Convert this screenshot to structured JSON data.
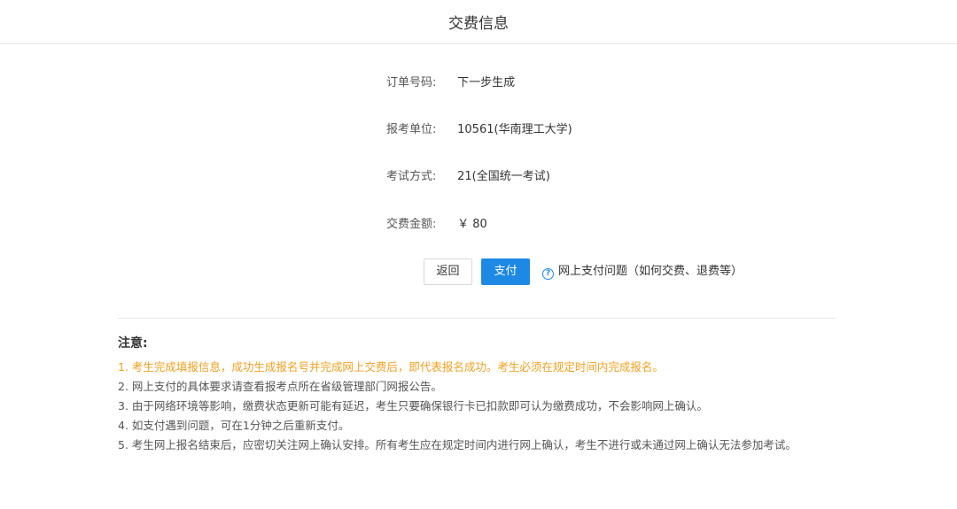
{
  "header": {
    "title": "交费信息"
  },
  "order": {
    "order_no_label": "订单号码:",
    "order_no_value": "下一步生成",
    "unit_label": "报考单位:",
    "unit_value": "10561(华南理工大学)",
    "exam_label": "考试方式:",
    "exam_value": "21(全国统一考试)",
    "amount_label": "交费金额:",
    "amount_value": "￥ 80"
  },
  "actions": {
    "back_label": "返回",
    "pay_label": "支付",
    "help_icon": "question-circle-icon",
    "help_label": "网上支付问题（如何交费、退费等）"
  },
  "notice": {
    "title": "注意:",
    "items": [
      "1. 考生完成填报信息，成功生成报名号并完成网上交费后，即代表报名成功。考生必须在规定时间内完成报名。",
      "2. 网上支付的具体要求请查看报考点所在省级管理部门网报公告。",
      "3. 由于网络环境等影响，缴费状态更新可能有延迟，考生只要确保银行卡已扣款即可认为缴费成功，不会影响网上确认。",
      "4. 如支付遇到问题，可在1分钟之后重新支付。",
      "5. 考生网上报名结束后，应密切关注网上确认安排。所有考生应在规定时间内进行网上确认，考生不进行或未通过网上确认无法参加考试。"
    ]
  },
  "colors": {
    "primary": "#1e88e5",
    "highlight": "#f0a020",
    "divider": "#e6e6e6"
  }
}
